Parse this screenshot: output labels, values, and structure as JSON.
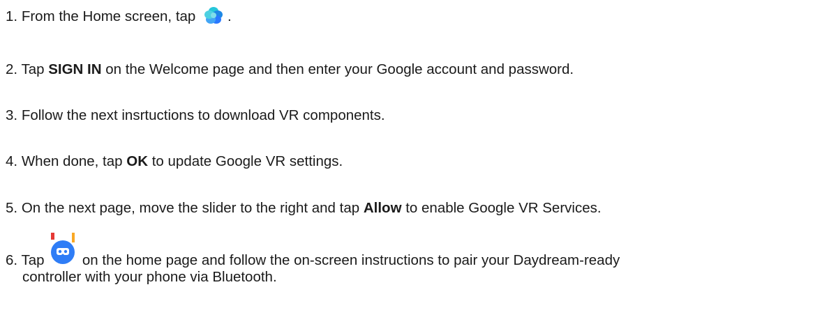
{
  "steps": [
    {
      "num": "1.",
      "before": "From the Home screen, tap",
      "icon": "daydream-app-icon",
      "after": "."
    },
    {
      "num": "2.",
      "before": "Tap",
      "bold": "SIGN IN",
      "after": "on the Welcome page and then enter your Google account and password."
    },
    {
      "num": "3.",
      "text": "Follow the next insrtuctions to download VR components."
    },
    {
      "num": "4.",
      "before": "When done, tap",
      "bold": "OK",
      "after": "to update Google VR settings."
    },
    {
      "num": "5.",
      "before": " On the next page, move the slider to the right and tap",
      "bold": "Allow",
      "after": "to enable Google VR Services."
    },
    {
      "num": "6.",
      "before": "Tap",
      "icon": "vr-headset-icon",
      "after": "on the home page and follow the on-screen instructions to pair your Daydream-ready",
      "continuation": "controller with your phone via Bluetooth."
    }
  ],
  "colors": {
    "text": "#1a1a1a",
    "daydream_icon_primary": "#2979ff",
    "daydream_icon_secondary": "#26c6da",
    "vr_icon_blue": "#2f7df6"
  }
}
